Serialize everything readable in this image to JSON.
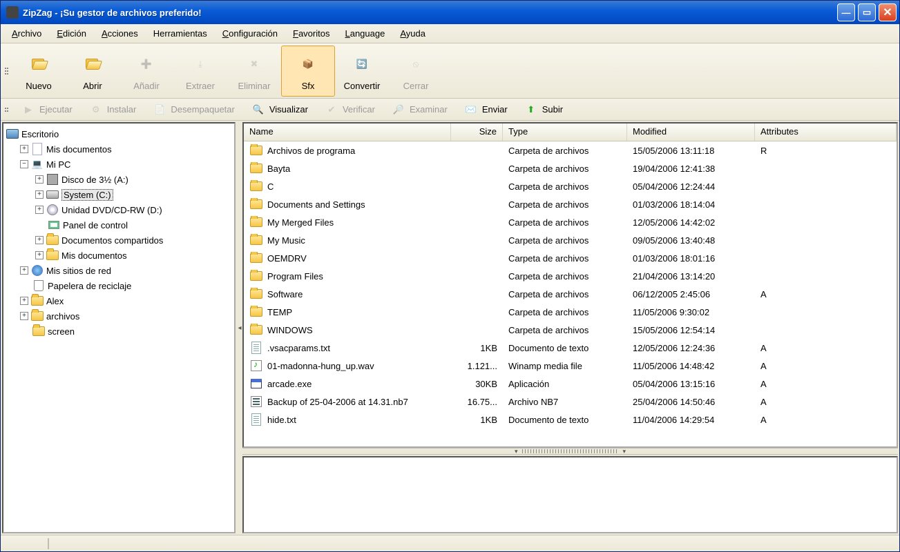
{
  "window": {
    "title": "ZipZag - ¡Su gestor de archivos preferido!"
  },
  "menu": {
    "items": [
      {
        "label": "Archivo",
        "u": 0
      },
      {
        "label": "Edición",
        "u": 0
      },
      {
        "label": "Acciones",
        "u": 0
      },
      {
        "label": "Herramientas",
        "u": -1
      },
      {
        "label": "Configuración",
        "u": 0
      },
      {
        "label": "Favoritos",
        "u": 0
      },
      {
        "label": "Language",
        "u": 0
      },
      {
        "label": "Ayuda",
        "u": 0
      }
    ]
  },
  "toolbar1": {
    "nuevo": "Nuevo",
    "abrir": "Abrir",
    "anadir": "Añadir",
    "extraer": "Extraer",
    "eliminar": "Eliminar",
    "sfx": "Sfx",
    "convertir": "Convertir",
    "cerrar": "Cerrar"
  },
  "toolbar2": {
    "ejecutar": "Ejecutar",
    "instalar": "Instalar",
    "desempaquetar": "Desempaquetar",
    "visualizar": "Visualizar",
    "verificar": "Verificar",
    "examinar": "Examinar",
    "enviar": "Enviar",
    "subir": "Subir"
  },
  "tree": {
    "root": "Escritorio",
    "misdoc": "Mis documentos",
    "mipc": "Mi PC",
    "floppy": "Disco de 3½ (A:)",
    "system": "System (C:)",
    "dvd": "Unidad DVD/CD-RW (D:)",
    "panel": "Panel de control",
    "shared": "Documentos compartidos",
    "misdoc2": "Mis documentos",
    "net": "Mis sitios de red",
    "trash": "Papelera de reciclaje",
    "alex": "Alex",
    "archivos": "archivos",
    "screen": "screen"
  },
  "columns": {
    "name": "Name",
    "size": "Size",
    "type": "Type",
    "modified": "Modified",
    "attributes": "Attributes"
  },
  "files": [
    {
      "icon": "folder",
      "name": "Archivos de programa",
      "size": "",
      "type": "Carpeta de archivos",
      "mod": "15/05/2006 13:11:18",
      "attr": "R"
    },
    {
      "icon": "folder",
      "name": "Bayta",
      "size": "",
      "type": "Carpeta de archivos",
      "mod": "19/04/2006 12:41:38",
      "attr": ""
    },
    {
      "icon": "folder",
      "name": "C",
      "size": "",
      "type": "Carpeta de archivos",
      "mod": "05/04/2006 12:24:44",
      "attr": ""
    },
    {
      "icon": "folder",
      "name": "Documents and Settings",
      "size": "",
      "type": "Carpeta de archivos",
      "mod": "01/03/2006 18:14:04",
      "attr": ""
    },
    {
      "icon": "folder",
      "name": "My Merged Files",
      "size": "",
      "type": "Carpeta de archivos",
      "mod": "12/05/2006 14:42:02",
      "attr": ""
    },
    {
      "icon": "folder",
      "name": "My Music",
      "size": "",
      "type": "Carpeta de archivos",
      "mod": "09/05/2006 13:40:48",
      "attr": ""
    },
    {
      "icon": "folder",
      "name": "OEMDRV",
      "size": "",
      "type": "Carpeta de archivos",
      "mod": "01/03/2006 18:01:16",
      "attr": ""
    },
    {
      "icon": "folder",
      "name": "Program Files",
      "size": "",
      "type": "Carpeta de archivos",
      "mod": "21/04/2006 13:14:20",
      "attr": ""
    },
    {
      "icon": "folder",
      "name": "Software",
      "size": "",
      "type": "Carpeta de archivos",
      "mod": "06/12/2005 2:45:06",
      "attr": "A"
    },
    {
      "icon": "folder",
      "name": "TEMP",
      "size": "",
      "type": "Carpeta de archivos",
      "mod": "11/05/2006 9:30:02",
      "attr": ""
    },
    {
      "icon": "folder",
      "name": "WINDOWS",
      "size": "",
      "type": "Carpeta de archivos",
      "mod": "15/05/2006 12:54:14",
      "attr": ""
    },
    {
      "icon": "txt",
      "name": ".vsacparams.txt",
      "size": "1KB",
      "type": "Documento de texto",
      "mod": "12/05/2006 12:24:36",
      "attr": "A"
    },
    {
      "icon": "wav",
      "name": "01-madonna-hung_up.wav",
      "size": "1.121...",
      "type": "Winamp media file",
      "mod": "11/05/2006 14:48:42",
      "attr": "A"
    },
    {
      "icon": "app",
      "name": "arcade.exe",
      "size": "30KB",
      "type": "Aplicación",
      "mod": "05/04/2006 13:15:16",
      "attr": "A"
    },
    {
      "icon": "nb7",
      "name": "Backup of 25-04-2006 at 14.31.nb7",
      "size": "16.75...",
      "type": "Archivo NB7",
      "mod": "25/04/2006 14:50:46",
      "attr": "A"
    },
    {
      "icon": "txt",
      "name": "hide.txt",
      "size": "1KB",
      "type": "Documento de texto",
      "mod": "11/04/2006 14:29:54",
      "attr": "A"
    }
  ]
}
